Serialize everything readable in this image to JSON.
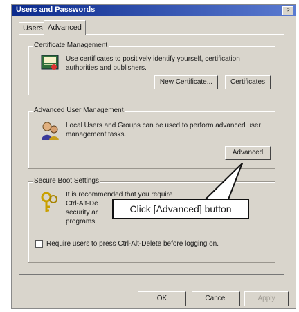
{
  "window": {
    "title": "Users and Passwords",
    "help_glyph": "?"
  },
  "tabs": [
    {
      "label": "Users"
    },
    {
      "label": "Advanced"
    }
  ],
  "certificate": {
    "title": "Certificate Management",
    "description": "Use certificates to positively identify yourself, certification authorities and publishers.",
    "buttons": {
      "new_certificate": "New Certificate...",
      "certificates": "Certificates"
    }
  },
  "advanced_user": {
    "title": "Advanced User Management",
    "description": "Local Users and Groups can be used to perform advanced user management tasks.",
    "button": "Advanced"
  },
  "secure_boot": {
    "title": "Secure Boot Settings",
    "description_lines": [
      "It is recommended that you require",
      "Ctrl-Alt-De",
      "security ar",
      "programs."
    ],
    "checkbox_label": "Require users to press Ctrl-Alt-Delete before logging on."
  },
  "callout": {
    "text": "Click [Advanced] button"
  },
  "footer": {
    "ok": "OK",
    "cancel": "Cancel",
    "apply": "Apply"
  }
}
